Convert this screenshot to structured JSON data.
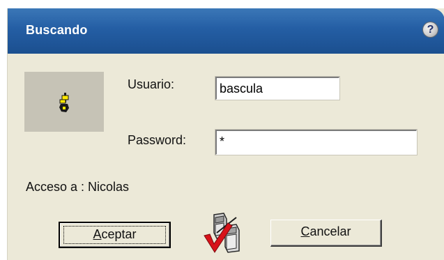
{
  "window": {
    "title": "Buscando",
    "help_label": "?"
  },
  "form": {
    "usuario_label": "Usuario:",
    "usuario_value": "bascula",
    "password_label": "Password:",
    "password_value": "*",
    "access_text": "Acceso a : Nicolas"
  },
  "buttons": {
    "accept_mnemonic": "A",
    "accept_rest": "ceptar",
    "cancel_mnemonic": "C",
    "cancel_rest": "ancelar"
  },
  "icons": {
    "user_icon": "user-lock-icon",
    "validate_icon": "server-check-icon",
    "accent_color": "#245ea4"
  }
}
